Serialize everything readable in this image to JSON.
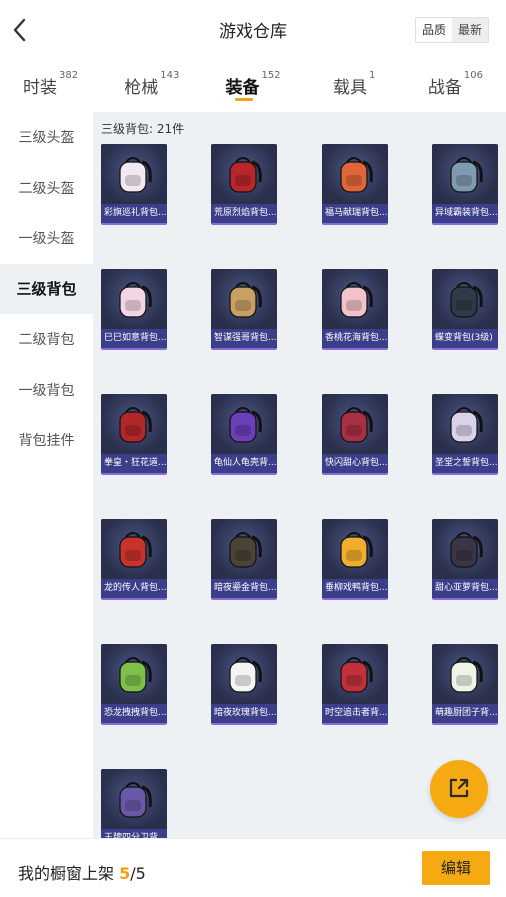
{
  "header": {
    "title": "游戏仓库",
    "sort": {
      "quality": "品质",
      "latest": "最新",
      "active": "latest"
    }
  },
  "tabs": [
    {
      "label": "时装",
      "count": "382",
      "active": false
    },
    {
      "label": "枪械",
      "count": "143",
      "active": false
    },
    {
      "label": "装备",
      "count": "152",
      "active": true
    },
    {
      "label": "载具",
      "count": "1",
      "active": false
    },
    {
      "label": "战备",
      "count": "106",
      "active": false
    }
  ],
  "sidebar": {
    "items": [
      {
        "label": "三级头盔",
        "active": false
      },
      {
        "label": "二级头盔",
        "active": false
      },
      {
        "label": "一级头盔",
        "active": false
      },
      {
        "label": "三级背包",
        "active": true
      },
      {
        "label": "二级背包",
        "active": false
      },
      {
        "label": "一级背包",
        "active": false
      },
      {
        "label": "背包挂件",
        "active": false
      }
    ]
  },
  "content": {
    "section_label": "三级背包: 21件",
    "items": [
      {
        "name": "彩旗巡礼背包...",
        "color": "#f2e9f0"
      },
      {
        "name": "荒原烈焰背包...",
        "color": "#b8262c"
      },
      {
        "name": "福马献瑞背包...",
        "color": "#e0663a"
      },
      {
        "name": "异域霸装背包...",
        "color": "#7f9bb0"
      },
      {
        "name": "巳巳如意背包...",
        "color": "#f3d6e4"
      },
      {
        "name": "智谋强哥背包...",
        "color": "#c9a063"
      },
      {
        "name": "香桃花海背包...",
        "color": "#f1c2c9"
      },
      {
        "name": "蝶变背包(3级)",
        "color": "#2f3a48"
      },
      {
        "name": "拳皇・狂花道...",
        "color": "#b2272a"
      },
      {
        "name": "龟仙人龟壳背...",
        "color": "#6a3fb8"
      },
      {
        "name": "快闪甜心背包...",
        "color": "#a83045"
      },
      {
        "name": "圣堂之誓背包...",
        "color": "#d9d2e8"
      },
      {
        "name": "龙的传人背包...",
        "color": "#c8322d"
      },
      {
        "name": "暗夜鎏金背包...",
        "color": "#4a4436"
      },
      {
        "name": "垂柳戏鸭背包...",
        "color": "#f1ae2e"
      },
      {
        "name": "甜心亚萝背包...",
        "color": "#3a3446"
      },
      {
        "name": "恐龙拽拽背包...",
        "color": "#7ec04a"
      },
      {
        "name": "暗夜玫瑰背包...",
        "color": "#f4f4f4"
      },
      {
        "name": "时空追击者背...",
        "color": "#c2303a"
      },
      {
        "name": "萌趣厨团子背...",
        "color": "#eef4e6"
      },
      {
        "name": "王牌四分卫背...",
        "color": "#6a58a8"
      }
    ]
  },
  "footer": {
    "label": "我的橱窗上架 ",
    "current": "5",
    "sep_total": "/5",
    "edit_label": "编辑"
  },
  "colors": {
    "accent": "#f6aa12",
    "content_bg": "#eef1f4",
    "card_bg": "#2f3558",
    "card_label_bg": "#3b3f8a"
  }
}
